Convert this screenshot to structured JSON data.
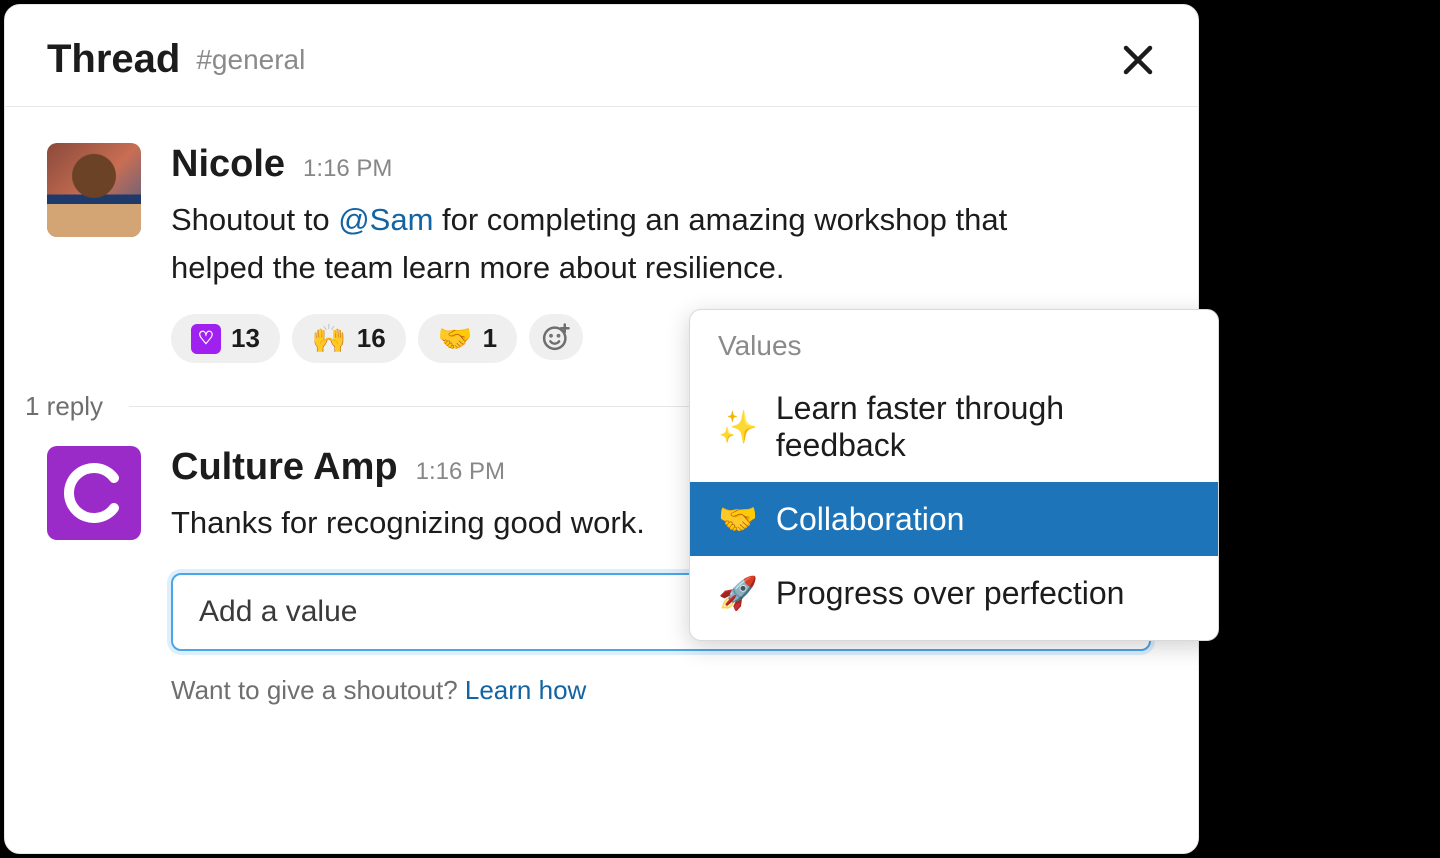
{
  "header": {
    "title": "Thread",
    "channel": "#general"
  },
  "messages": {
    "original": {
      "author": "Nicole",
      "time": "1:16 PM",
      "text_prefix": "Shoutout to ",
      "mention": "@Sam",
      "text_suffix": " for completing an amazing workshop that helped the team learn more about resilience.",
      "reactions": [
        {
          "emoji": "heart-square",
          "count": "13"
        },
        {
          "emoji": "🙌",
          "count": "16"
        },
        {
          "emoji": "🤝",
          "count": "1"
        }
      ]
    },
    "reply": {
      "author": "Culture Amp",
      "time": "1:16 PM",
      "text": "Thanks for recognizing good work.",
      "select_placeholder": "Add a value",
      "hint_prefix": "Want to give a shoutout? ",
      "hint_link": "Learn how"
    }
  },
  "reply_count": "1 reply",
  "dropdown": {
    "title": "Values",
    "items": [
      {
        "emoji": "✨",
        "label": "Learn faster through feedback",
        "selected": false
      },
      {
        "emoji": "🤝",
        "label": "Collaboration",
        "selected": true
      },
      {
        "emoji": "🚀",
        "label": "Progress over perfection",
        "selected": false
      }
    ]
  }
}
